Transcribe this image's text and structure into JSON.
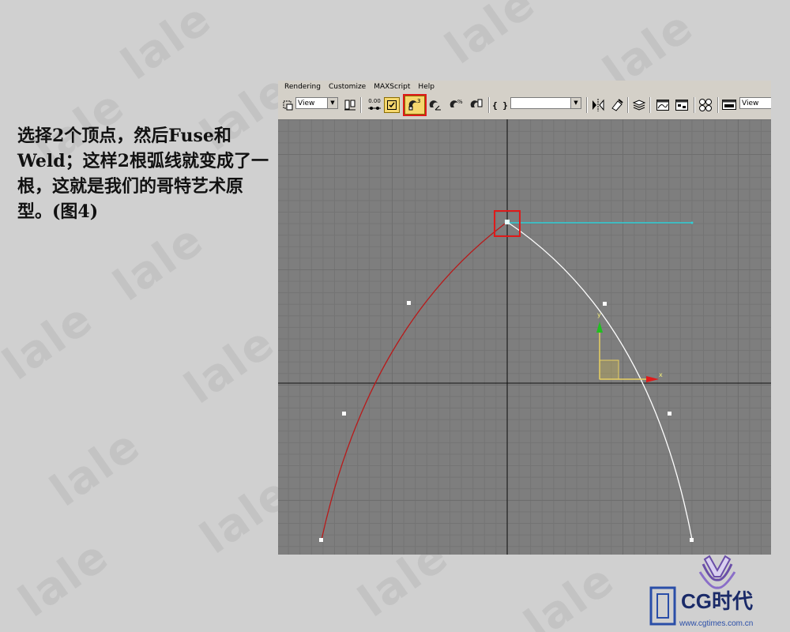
{
  "caption": "选择2个顶点，然后Fuse和Weld；这样2根弧线就变成了一根，这就是我们的哥特艺术原型。(图4)",
  "watermark_text": "lale",
  "menu": {
    "items": [
      "Rendering",
      "Customize",
      "MAXScript",
      "Help"
    ]
  },
  "toolbar": {
    "view_dropdown_left": "View",
    "spinner_value": "0.00",
    "named_selection_value": "",
    "view_dropdown_right": "View"
  },
  "viewport": {
    "axis_y_label": "y",
    "axis_x_label": "x"
  },
  "icons": {
    "selected_tool": "snap-magnet-icon",
    "highlighted_button": "snaps-toggle-icon"
  },
  "colors": {
    "left_arc": "#b81a1a",
    "right_arc": "#ffffff",
    "cyan_line": "#2fd0d8",
    "highlight_box": "#e01a1a",
    "active_toggle": "#f5d76e"
  },
  "logo": {
    "brand": "CG时代",
    "url": "www.cgtimes.com.cn"
  }
}
